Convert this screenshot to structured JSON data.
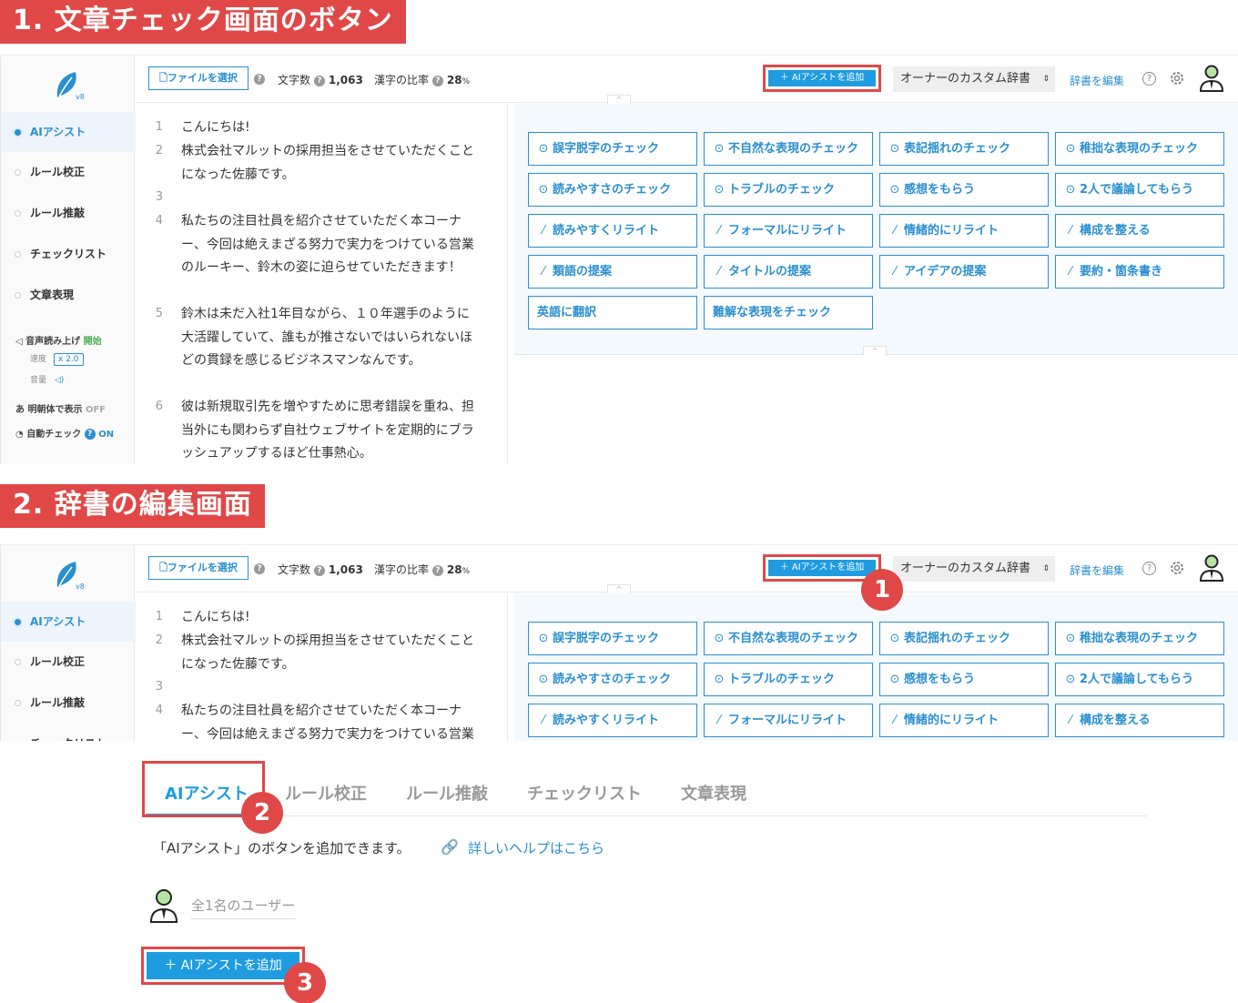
{
  "sections": {
    "s1": "1. 文章チェック画面のボタン",
    "s2": "2. 辞書の編集画面"
  },
  "logo_version": "v8",
  "sidebar": {
    "items": [
      "AIアシスト",
      "ルール校正",
      "ルール推敲",
      "チェックリスト",
      "文章表現"
    ],
    "voice_label": "音声読み上げ",
    "voice_status": "開始",
    "speed_label": "速度",
    "speed_value": "x 2.0",
    "volume_label": "音量",
    "mincho_label": "明朝体で表示",
    "mincho_status": "OFF",
    "auto_check_label": "自動チェック",
    "auto_check_status": "ON"
  },
  "topbar": {
    "file_button": "ファイルを選択",
    "char_count_label": "文字数",
    "char_count": "1,063",
    "kanji_label": "漢字の比率",
    "kanji_value": "28",
    "kanji_unit": "%",
    "ai_add_button": "＋ AIアシストを追加",
    "dictionary_select": "オーナーのカスタム辞書",
    "dictionary_edit": "辞書を編集"
  },
  "editor_lines": [
    {
      "num": "1",
      "text": "こんにちは!"
    },
    {
      "num": "2",
      "text": "株式会社マルットの採用担当をさせていただくことになった佐藤です。"
    },
    {
      "num": "3",
      "text": ""
    },
    {
      "num": "4",
      "text": "私たちの注目社員を紹介させていただく本コーナー、今回は絶えまざる努力で実力をつけている営業のルーキー、鈴木の姿に迫らせていただきます！"
    },
    {
      "num": "5",
      "text": "鈴木は未だ入社1年目ながら、１０年選手のように大活躍していて、誰もが推さないではいられないほどの貫録を感じるビジネスマンなんです。"
    },
    {
      "num": "6",
      "text": "彼は新規取引先を増やすために思考錯誤を重ね、担当外にも関わらず自社ウェブサイトを定期的にブラッシュアップするほど仕事熱心。"
    }
  ],
  "chips": [
    {
      "icon": "check-circle",
      "label": "誤字脱字のチェック"
    },
    {
      "icon": "check-circle",
      "label": "不自然な表現のチェック"
    },
    {
      "icon": "check-circle",
      "label": "表記揺れのチェック"
    },
    {
      "icon": "check-circle",
      "label": "稚拙な表現のチェック"
    },
    {
      "icon": "check-circle",
      "label": "読みやすさのチェック"
    },
    {
      "icon": "check-circle",
      "label": "トラブルのチェック"
    },
    {
      "icon": "check-circle",
      "label": "感想をもらう"
    },
    {
      "icon": "check-circle",
      "label": "2人で議論してもらう"
    },
    {
      "icon": "pencil",
      "label": "読みやすくリライト"
    },
    {
      "icon": "pencil",
      "label": "フォーマルにリライト"
    },
    {
      "icon": "pencil",
      "label": "情緒的にリライト"
    },
    {
      "icon": "pencil",
      "label": "構成を整える"
    },
    {
      "icon": "pencil",
      "label": "類語の提案"
    },
    {
      "icon": "pencil",
      "label": "タイトルの提案"
    },
    {
      "icon": "pencil",
      "label": "アイデアの提案"
    },
    {
      "icon": "pencil",
      "label": "要約・箇条書き"
    },
    {
      "icon": "none",
      "label": "英語に翻訳"
    },
    {
      "icon": "none",
      "label": "難解な表現をチェック"
    }
  ],
  "dict_editor": {
    "tabs": [
      "AIアシスト",
      "ルール校正",
      "ルール推敲",
      "チェックリスト",
      "文章表現"
    ],
    "description": "「AIアシスト」のボタンを追加できます。",
    "help_link": "詳しいヘルプはこちら",
    "users": "全1名のユーザー",
    "add_button": "＋ AIアシストを追加"
  },
  "badges": [
    "1",
    "2",
    "3"
  ],
  "colors": {
    "accent_red": "#e04848",
    "primary_blue": "#1f9ce0",
    "link_blue": "#2a8fcf"
  }
}
